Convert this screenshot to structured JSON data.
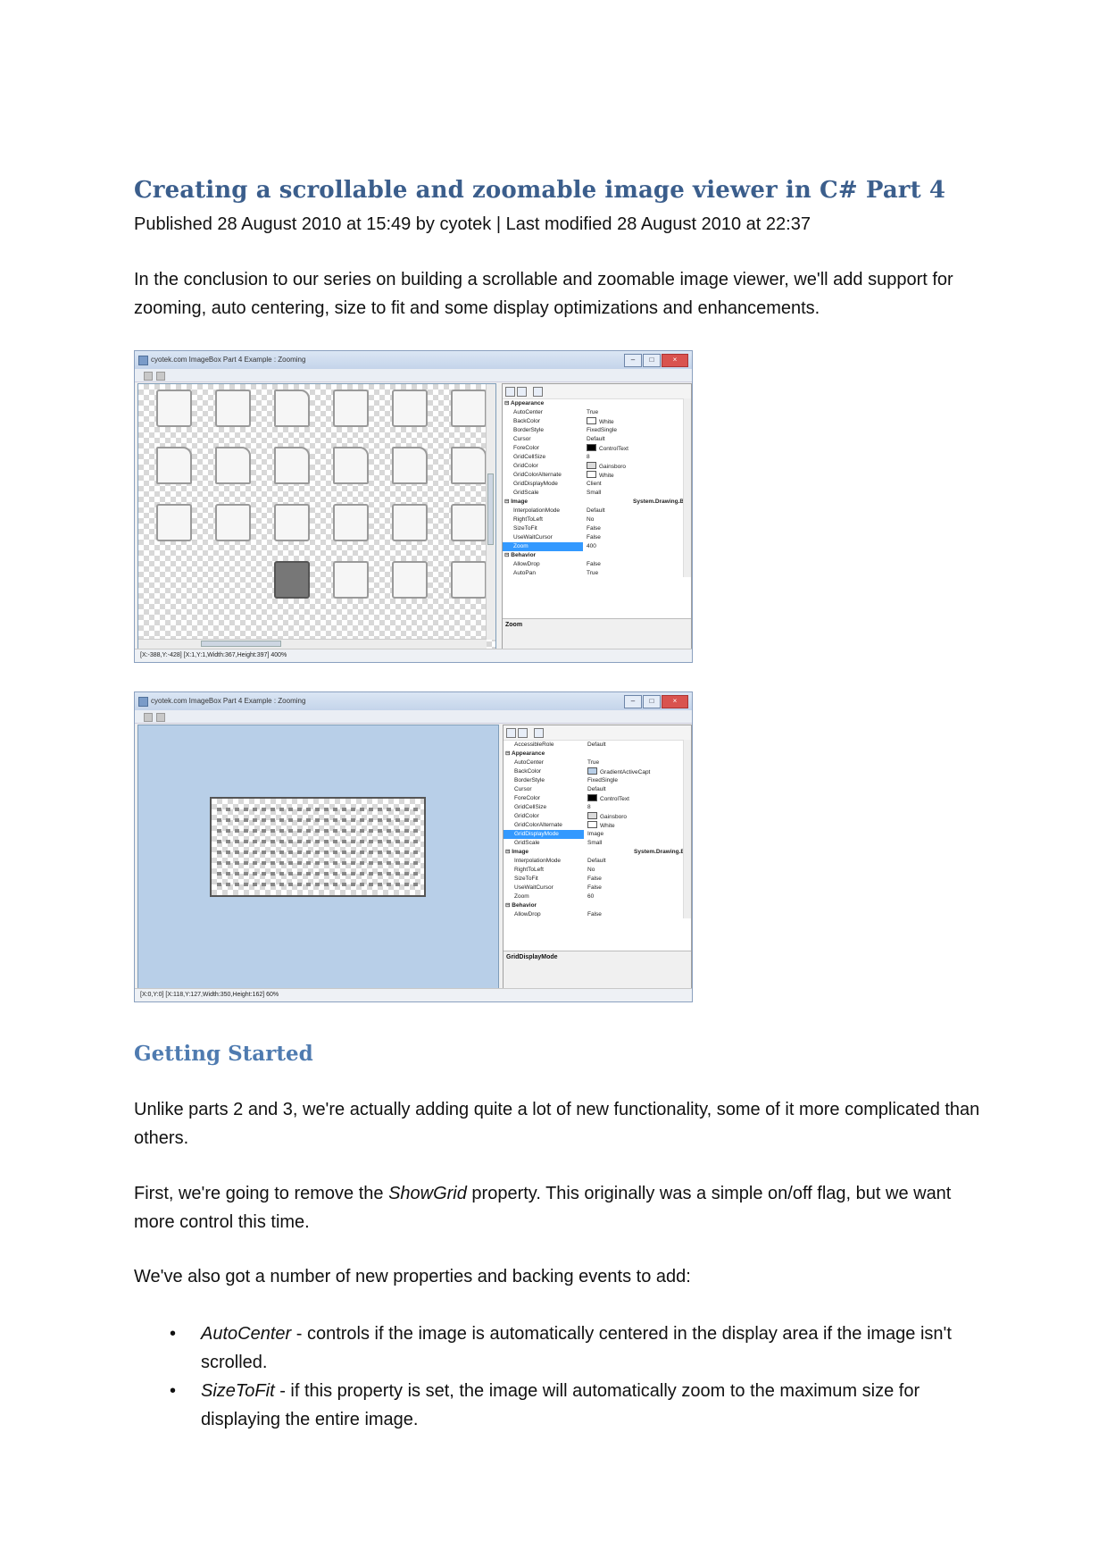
{
  "article": {
    "title": "Creating a scrollable and zoomable image viewer in C# Part 4",
    "meta": "Published 28 August 2010 at 15:49 by cyotek | Last modified 28 August 2010 at 22:37",
    "intro": "In the conclusion to our series on building a scrollable and zoomable image viewer, we'll add support for zooming, auto centering, size to fit and some display optimizations and enhancements."
  },
  "screenshot1": {
    "window_title": "cyotek.com ImageBox Part 4 Example : Zooming",
    "status": "[X:-388,Y:-428]  [X:1,Y:1,Width:367,Height:397]  400%",
    "description_title": "Zoom",
    "properties": [
      {
        "name": "Appearance",
        "value": "",
        "cat": true
      },
      {
        "name": "AutoCenter",
        "value": "True"
      },
      {
        "name": "BackColor",
        "value": "White",
        "swatch": "#ffffff"
      },
      {
        "name": "BorderStyle",
        "value": "FixedSingle"
      },
      {
        "name": "Cursor",
        "value": "Default"
      },
      {
        "name": "ForeColor",
        "value": "ControlText",
        "swatch": "#000000"
      },
      {
        "name": "GridCellSize",
        "value": "8"
      },
      {
        "name": "GridColor",
        "value": "Gainsboro",
        "swatch": "#dcdcdc"
      },
      {
        "name": "GridColorAlternate",
        "value": "White",
        "swatch": "#ffffff"
      },
      {
        "name": "GridDisplayMode",
        "value": "Client"
      },
      {
        "name": "GridScale",
        "value": "Small"
      },
      {
        "name": "Image",
        "value": "System.Drawing.Bit",
        "cat": true
      },
      {
        "name": "InterpolationMode",
        "value": "Default"
      },
      {
        "name": "RightToLeft",
        "value": "No"
      },
      {
        "name": "SizeToFit",
        "value": "False"
      },
      {
        "name": "UseWaitCursor",
        "value": "False"
      },
      {
        "name": "Zoom",
        "value": "400",
        "sel": true
      },
      {
        "name": "Behavior",
        "value": "",
        "cat": true
      },
      {
        "name": "AllowDrop",
        "value": "False"
      },
      {
        "name": "AutoPan",
        "value": "True"
      }
    ]
  },
  "screenshot2": {
    "window_title": "cyotek.com ImageBox Part 4 Example : Zooming",
    "status": "[X:0,Y:0]  [X:118,Y:127,Width:350,Height:162]  60%",
    "description_title": "GridDisplayMode",
    "properties": [
      {
        "name": "AccessibleRole",
        "value": "Default"
      },
      {
        "name": "Appearance",
        "value": "",
        "cat": true
      },
      {
        "name": "AutoCenter",
        "value": "True"
      },
      {
        "name": "BackColor",
        "value": "GradientActiveCapt",
        "swatch": "#b8cfe8"
      },
      {
        "name": "BorderStyle",
        "value": "FixedSingle"
      },
      {
        "name": "Cursor",
        "value": "Default"
      },
      {
        "name": "ForeColor",
        "value": "ControlText",
        "swatch": "#000000"
      },
      {
        "name": "GridCellSize",
        "value": "8"
      },
      {
        "name": "GridColor",
        "value": "Gainsboro",
        "swatch": "#dcdcdc"
      },
      {
        "name": "GridColorAlternate",
        "value": "White",
        "swatch": "#ffffff"
      },
      {
        "name": "GridDisplayMode",
        "value": "Image",
        "sel": true
      },
      {
        "name": "GridScale",
        "value": "Small"
      },
      {
        "name": "Image",
        "value": "System.Drawing.Bit",
        "cat": true
      },
      {
        "name": "InterpolationMode",
        "value": "Default"
      },
      {
        "name": "RightToLeft",
        "value": "No"
      },
      {
        "name": "SizeToFit",
        "value": "False"
      },
      {
        "name": "UseWaitCursor",
        "value": "False"
      },
      {
        "name": "Zoom",
        "value": "60"
      },
      {
        "name": "Behavior",
        "value": "",
        "cat": true
      },
      {
        "name": "AllowDrop",
        "value": "False"
      }
    ]
  },
  "getting_started": {
    "heading": "Getting Started",
    "p1": "Unlike parts 2 and 3, we're actually adding quite a lot of new functionality, some of it more complicated than others.",
    "p2_before": "First, we're going to remove the ",
    "p2_em": "ShowGrid",
    "p2_after": " property. This originally was a simple on/off flag, but we want more control this time.",
    "p3": "We've also got a number of new properties and backing events to add:",
    "bullets": [
      {
        "em": "AutoCenter",
        "text": " - controls if the image is automatically centered in the display area if the image isn't scrolled."
      },
      {
        "em": "SizeToFit",
        "text": " - if this property is set, the image will automatically zoom to the maximum size for displaying the entire image."
      }
    ]
  }
}
